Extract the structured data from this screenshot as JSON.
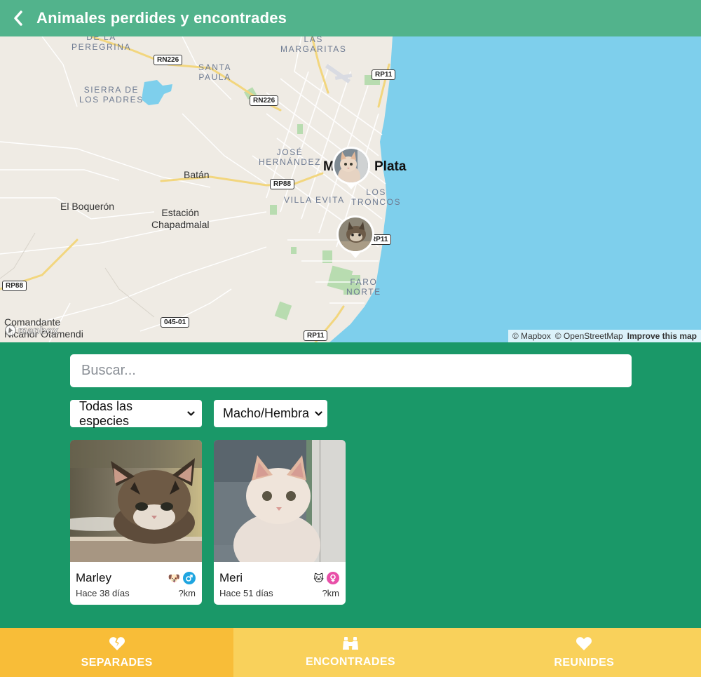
{
  "header": {
    "title": "Animales perdides y encontrades",
    "back_icon": "chevron-left-icon"
  },
  "map": {
    "places": {
      "de_la_peregrina": "DE LA\nPEREGRINA",
      "las_margaritas": "LAS\nMARGARITAS",
      "santa_paula": "SANTA\nPAULA",
      "sierra_de_los_padres": "SIERRA DE\nLOS PADRES",
      "jose_hernandez": "JOSÉ\nHERNÁNDEZ",
      "villa_evita": "VILLA EVITA",
      "los_troncos": "LOS\nTRONCOS",
      "faro_norte": "FARO\nNORTE",
      "batan": "Batán",
      "el_boqueron": "El Boquerón",
      "estacion_chapadmalal": "Estación\nChapadmalal",
      "comandante_otamendi": "Comandante\nNicanor Otamendi",
      "city_prefix": "M",
      "city_suffix": "Plata"
    },
    "roads": {
      "rn226_a": "RN226",
      "rn226_b": "RN226",
      "rp11_a": "RP11",
      "rp11_b": "RP11",
      "rp11_c": "RP11",
      "rp88_a": "RP88",
      "rp88_b": "RP88",
      "r045": "045-01"
    },
    "attribution": {
      "mapbox": "© Mapbox",
      "osm": "© OpenStreetMap",
      "improve": "Improve this map"
    },
    "logo": "mapbox",
    "colors": {
      "land": "#efebe4",
      "water": "#7ecfec",
      "park": "#b8dcb0",
      "road": "#ffffff",
      "highway": "#f2d67e"
    }
  },
  "search": {
    "placeholder": "Buscar...",
    "value": ""
  },
  "filters": {
    "species": {
      "selected": "Todas las especies"
    },
    "sex": {
      "selected": "Macho/Hembra"
    }
  },
  "cards": [
    {
      "name": "Marley",
      "ago": "Hace 38 días",
      "distance": "?km",
      "species_emoji": "🐶",
      "sex": "male",
      "sex_color": "#1fa5e0"
    },
    {
      "name": "Meri",
      "ago": "Hace 51 días",
      "distance": "?km",
      "species_emoji": "🐱",
      "sex": "female",
      "sex_color": "#e84fa8"
    }
  ],
  "tabs": [
    {
      "label": "SEPARADES",
      "icon": "broken-heart-icon",
      "active": true
    },
    {
      "label": "ENCONTRADES",
      "icon": "binoculars-icon",
      "active": false
    },
    {
      "label": "REUNIDES",
      "icon": "heart-icon",
      "active": false
    }
  ],
  "colors": {
    "header": "#52b38c",
    "main_bg": "#1a9868",
    "tab_active": "#f8bd38",
    "tab_inactive": "#f9d15b"
  }
}
